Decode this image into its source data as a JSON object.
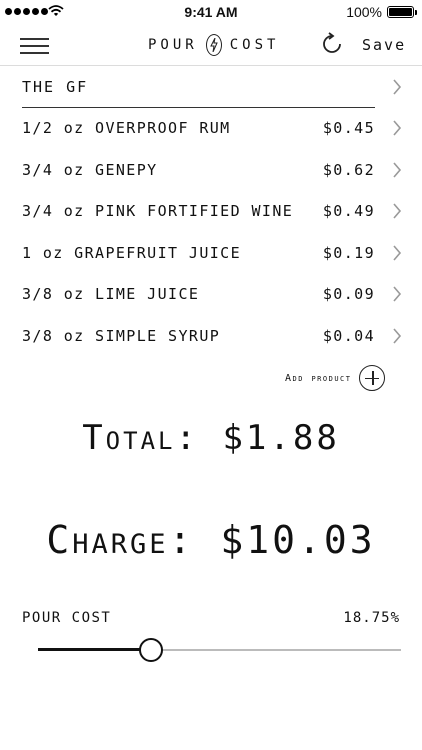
{
  "status_bar": {
    "time": "9:41 AM",
    "battery": "100%"
  },
  "nav": {
    "logo_left": "POUR",
    "logo_right": "COST",
    "save_label": "Save"
  },
  "recipe": {
    "title": "THE GF"
  },
  "ingredients": [
    {
      "name": "1/2 oz OVERPROOF RUM",
      "price": "$0.45"
    },
    {
      "name": "3/4 oz GENEPY",
      "price": "$0.62"
    },
    {
      "name": "3/4 oz PINK FORTIFIED WINE",
      "price": "$0.49"
    },
    {
      "name": "1 oz GRAPEFRUIT JUICE",
      "price": "$0.19"
    },
    {
      "name": "3/8 oz LIME JUICE",
      "price": "$0.09"
    },
    {
      "name": "3/8 oz SIMPLE SYRUP",
      "price": "$0.04"
    }
  ],
  "add_product": {
    "label": "Add product"
  },
  "total": {
    "label": "Total:",
    "value": "$1.88"
  },
  "charge": {
    "label": "Charge:",
    "value": "$10.03"
  },
  "pour_cost": {
    "label": "POUR COST",
    "value": "18.75%",
    "slider_fraction": 0.31
  },
  "icons": {
    "menu": "hamburger-menu-icon",
    "refresh": "refresh-icon",
    "chevron": "chevron-right-icon",
    "add": "plus-circle-icon"
  }
}
